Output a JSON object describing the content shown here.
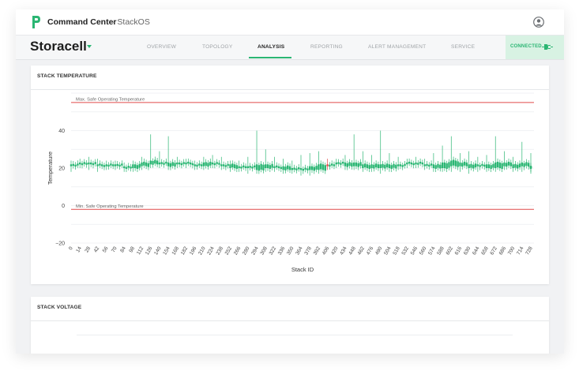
{
  "header": {
    "app_title": "Command Center",
    "app_subtitle": "- StackOS",
    "avatar_icon": "user-avatar-icon",
    "logo_icon": "p-logo-icon"
  },
  "nav": {
    "brand": "Storacell",
    "tabs": [
      {
        "label": "OVERVIEW",
        "active": false
      },
      {
        "label": "TOPOLOGY",
        "active": false
      },
      {
        "label": "ANALYSIS",
        "active": true
      },
      {
        "label": "REPORTING",
        "active": false
      },
      {
        "label": "ALERT MANAGEMENT",
        "active": false
      },
      {
        "label": "SERVICE",
        "active": false
      }
    ],
    "status": "CONNECTED",
    "status_icon": "plug-icon"
  },
  "colors": {
    "accent": "#2bb673",
    "limit_line": "#e04a4a",
    "highlight": "#e04a4a"
  },
  "cards": {
    "temperature_title": "STACK TEMPERATURE",
    "voltage_title": "STACK VOLTAGE"
  },
  "chart_data": {
    "type": "candlestick",
    "xlabel": "Stack ID",
    "ylabel": "Temperature",
    "ylim": [
      -20,
      60
    ],
    "yticks": [
      -20,
      0,
      20,
      40
    ],
    "xlim": [
      0,
      733
    ],
    "xticks": [
      0,
      14,
      28,
      42,
      56,
      70,
      84,
      98,
      112,
      126,
      140,
      154,
      168,
      182,
      196,
      210,
      224,
      238,
      252,
      266,
      280,
      294,
      308,
      322,
      336,
      350,
      364,
      378,
      392,
      406,
      420,
      434,
      448,
      462,
      476,
      490,
      504,
      518,
      532,
      546,
      560,
      574,
      588,
      602,
      616,
      630,
      644,
      658,
      672,
      686,
      700,
      714,
      728
    ],
    "reference_lines": [
      {
        "label": "Max. Safe Operating Temperature",
        "value": 55
      },
      {
        "label": "Min. Safe Operating Temperature",
        "value": -2
      }
    ],
    "grid": true,
    "highlight_x": 406,
    "series": [
      {
        "x": [
          0,
          14,
          28,
          42,
          56,
          70,
          84,
          98,
          112,
          126,
          140,
          154,
          168,
          182,
          196,
          210,
          224,
          238,
          252,
          266,
          280,
          294,
          308,
          322,
          336,
          350,
          364,
          378,
          392,
          406,
          420,
          434,
          448,
          462,
          476,
          490,
          504,
          518,
          532,
          546,
          560,
          574,
          588,
          602,
          616,
          630,
          644,
          658,
          672,
          686,
          700,
          714,
          728
        ],
        "low": [
          18,
          20,
          19,
          18,
          19,
          19,
          18,
          18,
          19,
          20,
          20,
          19,
          20,
          20,
          19,
          19,
          20,
          19,
          18,
          18,
          17,
          17,
          18,
          18,
          17,
          17,
          16,
          16,
          17,
          19,
          20,
          19,
          19,
          18,
          18,
          17,
          18,
          19,
          20,
          20,
          19,
          18,
          18,
          18,
          18,
          17,
          18,
          18,
          18,
          19,
          18,
          18,
          17
        ],
        "high": [
          24,
          25,
          26,
          25,
          24,
          24,
          23,
          24,
          26,
          38,
          29,
          37,
          26,
          25,
          24,
          26,
          27,
          26,
          24,
          24,
          26,
          40,
          30,
          26,
          25,
          24,
          27,
          28,
          29,
          25,
          25,
          27,
          38,
          29,
          27,
          40,
          28,
          26,
          25,
          26,
          25,
          28,
          32,
          37,
          28,
          29,
          26,
          27,
          37,
          29,
          26,
          34,
          28
        ],
        "open": [
          21,
          22,
          22,
          21,
          21,
          21,
          20,
          20,
          21,
          22,
          22,
          21,
          22,
          22,
          21,
          21,
          22,
          21,
          20,
          20,
          20,
          19,
          20,
          20,
          19,
          19,
          19,
          19,
          19,
          21,
          22,
          21,
          21,
          20,
          20,
          20,
          20,
          21,
          22,
          22,
          21,
          20,
          20,
          21,
          21,
          20,
          21,
          20,
          20,
          21,
          20,
          21,
          20
        ],
        "close": [
          22,
          23,
          23,
          22,
          22,
          22,
          21,
          22,
          23,
          24,
          23,
          23,
          23,
          23,
          22,
          23,
          23,
          22,
          22,
          21,
          21,
          22,
          22,
          21,
          21,
          20,
          20,
          21,
          22,
          22,
          23,
          23,
          23,
          22,
          22,
          22,
          22,
          22,
          23,
          23,
          22,
          22,
          23,
          24,
          23,
          22,
          22,
          22,
          23,
          23,
          22,
          23,
          21
        ]
      }
    ]
  }
}
